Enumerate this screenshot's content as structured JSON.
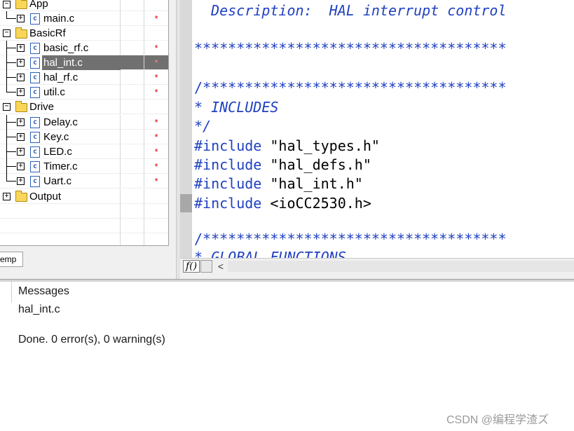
{
  "workspace": {
    "items": [
      {
        "label": "App",
        "type": "folder",
        "level": 0,
        "modified": ""
      },
      {
        "label": "main.c",
        "type": "file",
        "level": 1,
        "modified": "*"
      },
      {
        "label": "BasicRf",
        "type": "folder",
        "level": 0,
        "modified": ""
      },
      {
        "label": "basic_rf.c",
        "type": "file",
        "level": 1,
        "modified": "*"
      },
      {
        "label": "hal_int.c",
        "type": "file",
        "level": 1,
        "modified": "*",
        "selected": true
      },
      {
        "label": "hal_rf.c",
        "type": "file",
        "level": 1,
        "modified": "*"
      },
      {
        "label": "util.c",
        "type": "file",
        "level": 1,
        "modified": "*"
      },
      {
        "label": "Drive",
        "type": "folder",
        "level": 0,
        "modified": ""
      },
      {
        "label": "Delay.c",
        "type": "file",
        "level": 1,
        "modified": "*"
      },
      {
        "label": "Key.c",
        "type": "file",
        "level": 1,
        "modified": "*"
      },
      {
        "label": "LED.c",
        "type": "file",
        "level": 1,
        "modified": "*"
      },
      {
        "label": "Timer.c",
        "type": "file",
        "level": 1,
        "modified": "*"
      },
      {
        "label": "Uart.c",
        "type": "file",
        "level": 1,
        "modified": "*"
      },
      {
        "label": "Output",
        "type": "folder",
        "level": 0,
        "modified": ""
      }
    ],
    "tab_label": "emp",
    "icons": {
      "expand": "plus-box-icon",
      "folder": "folder-icon",
      "file": "c-file-icon"
    },
    "colors": {
      "selection": "#707070",
      "modified_mark": "#e00000",
      "folder": "#f7d658"
    }
  },
  "editor": {
    "lines": {
      "description": "  Description:  HAL interrupt control",
      "stars1": "*************************************",
      "stars2": "/************************************",
      "includes_comment": "* INCLUDES",
      "comment_end": "*/",
      "inc1_kw": "#include",
      "inc1_file": " \"hal_types.h\"",
      "inc2_kw": "#include",
      "inc2_file": " \"hal_defs.h\"",
      "inc3_kw": "#include",
      "inc3_file": " \"hal_int.h\"",
      "inc4_kw": "#include",
      "inc4_file": " <ioCC2530.h>",
      "stars3": "/************************************",
      "partial": "* GLOBAL FUNCTIONS"
    },
    "function_tab": "f()",
    "scroll_left_symbol": "<",
    "colors": {
      "comment": "#2040c0",
      "keyword": "#2040c0",
      "text": "#000000"
    }
  },
  "messages": {
    "header": "Messages",
    "lines": [
      "hal_int.c",
      "",
      "Done. 0 error(s), 0 warning(s)"
    ]
  },
  "watermark": "CSDN @编程学渣ズ"
}
